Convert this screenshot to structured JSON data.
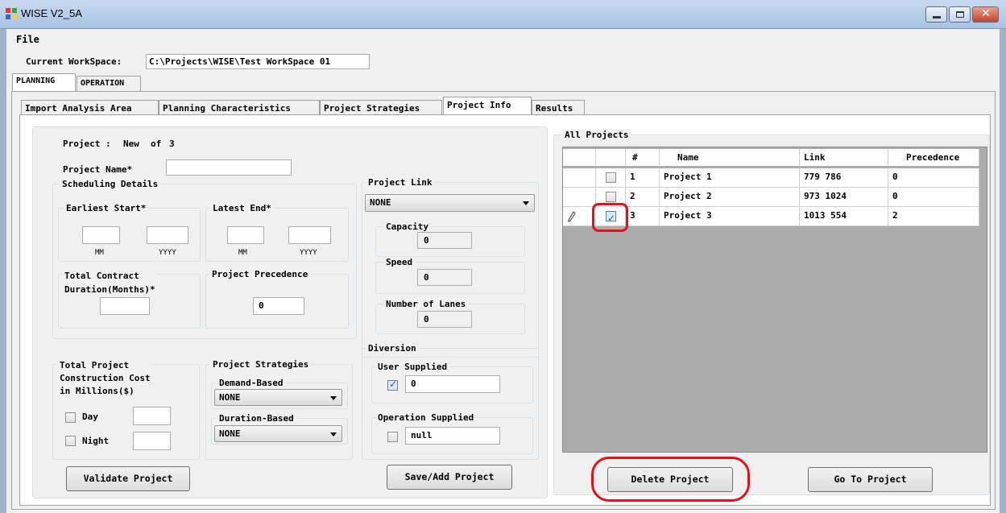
{
  "window": {
    "title": "WISE V2_5A"
  },
  "menu": {
    "file": "File"
  },
  "workspace": {
    "label": "Current WorkSpace:",
    "path": "C:\\Projects\\WISE\\Test WorkSpace 01"
  },
  "main_tabs": [
    "PLANNING",
    "OPERATION"
  ],
  "sub_tabs": [
    "Import Analysis Area",
    "Planning Characteristics",
    "Project Strategies",
    "Project Info",
    "Results"
  ],
  "form": {
    "project_label": "Project :",
    "project_status": "New",
    "of_label": "of",
    "project_count": "3",
    "project_name_label": "Project Name*",
    "scheduling_label": "Scheduling Details",
    "earliest_start_label": "Earliest Start*",
    "latest_end_label": "Latest End*",
    "mm": "MM",
    "yyyy": "YYYY",
    "total_contract_label": "Total Contract\nDuration(Months)*",
    "project_precedence_label": "Project Precedence",
    "project_precedence_value": "0",
    "project_link_label": "Project Link",
    "project_link_value": "NONE",
    "capacity_label": "Capacity",
    "capacity_value": "0",
    "speed_label": "Speed",
    "speed_value": "0",
    "lanes_label": "Number of Lanes",
    "lanes_value": "0",
    "cost_label": "Total Project\nConstruction Cost\nin Millions($)",
    "day_label": "Day",
    "night_label": "Night",
    "strategies_label": "Project Strategies",
    "demand_label": "Demand-Based",
    "demand_value": "NONE",
    "duration_label": "Duration-Based",
    "duration_value": "NONE",
    "diversion_label": "Diversion",
    "user_supplied_label": "User Supplied",
    "user_supplied_value": "0",
    "operation_supplied_label": "Operation Supplied",
    "operation_supplied_value": "null",
    "validate_button": "Validate Project",
    "save_button": "Save/Add Project"
  },
  "all_projects": {
    "label": "All Projects",
    "columns": [
      "#",
      "Name",
      "Link",
      "Precedence"
    ],
    "rows": [
      {
        "num": "1",
        "name": "Project 1",
        "link": "779 786",
        "precedence": "0",
        "checked": false
      },
      {
        "num": "2",
        "name": "Project 2",
        "link": "973 1024",
        "precedence": "0",
        "checked": false
      },
      {
        "num": "3",
        "name": "Project 3",
        "link": "1013 554",
        "precedence": "2",
        "checked": true
      }
    ],
    "delete_button": "Delete Project",
    "goto_button": "Go To Project"
  },
  "colors": {
    "highlight": "#e0131b",
    "grid_bg": "#ababab"
  }
}
